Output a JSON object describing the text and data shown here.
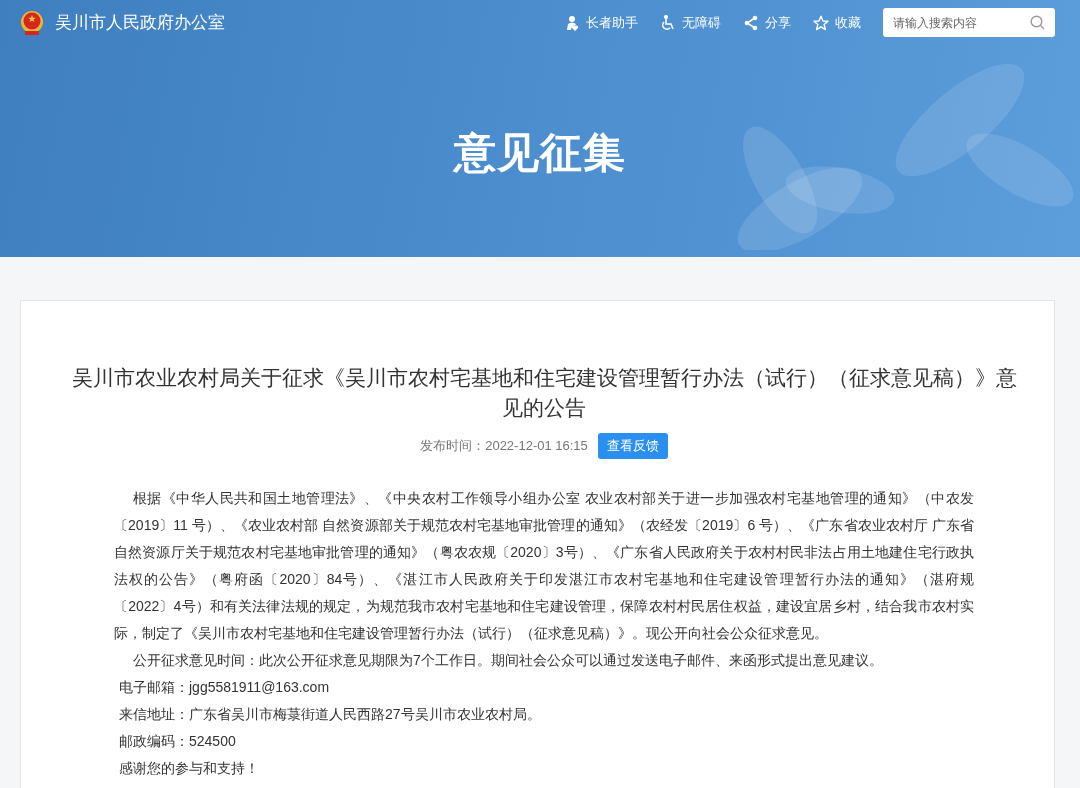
{
  "site": {
    "title": "吴川市人民政府办公室"
  },
  "nav": [
    {
      "kind": "elder",
      "label": "长者助手"
    },
    {
      "kind": "accessibility",
      "label": "无障碍"
    },
    {
      "kind": "share",
      "label": "分享"
    },
    {
      "kind": "favorite",
      "label": "收藏"
    }
  ],
  "search": {
    "placeholder": "请输入搜索内容"
  },
  "banner": {
    "title": "意见征集"
  },
  "article": {
    "title": "吴川市农业农村局关于征求《吴川市农村宅基地和住宅建设管理暂行办法（试行）（征求意见稿）》意见的公告",
    "publish_time": "发布时间：2022-12-01 16:15",
    "feedback_button": "查看反馈",
    "paragraphs": [
      {
        "kind": "indented",
        "text": "根据《中华人民共和国土地管理法》、《中央农村工作领导小组办公室 农业农村部关于进一步加强农村宅基地管理的通知》（中农发〔2019〕11 号）、《农业农村部 自然资源部关于规范农村宅基地审批管理的通知》（农经发〔2019〕6 号）、《广东省农业农村厅 广东省自然资源厅关于规范农村宅基地审批管理的通知》（粤农农规〔2020〕3号）、《广东省人民政府关于农村村民非法占用土地建住宅行政执法权的公告》（粤府函〔2020〕84号）、《湛江市人民政府关于印发湛江市农村宅基地和住宅建设管理暂行办法的通知》（湛府规〔2022〕4号）和有关法律法规的规定，为规范我市农村宅基地和住宅建设管理，保障农村村民居住权益，建设宜居乡村，结合我市农村实际，制定了《吴川市农村宅基地和住宅建设管理暂行办法（试行）（征求意见稿）》。现公开向社会公众征求意见。"
      },
      {
        "kind": "indented",
        "text": "公开征求意见时间：此次公开征求意见期限为7个工作日。期间社会公众可以通过发送电子邮件、来函形式提出意见建议。"
      },
      {
        "kind": "plain",
        "text": "电子邮箱：jgg5581911@163.com"
      },
      {
        "kind": "plain",
        "text": "来信地址：广东省吴川市梅菉街道人民西路27号吴川市农业农村局。"
      },
      {
        "kind": "plain",
        "text": "邮政编码：524500"
      },
      {
        "kind": "plain",
        "text": "感谢您的参与和支持！"
      }
    ]
  }
}
